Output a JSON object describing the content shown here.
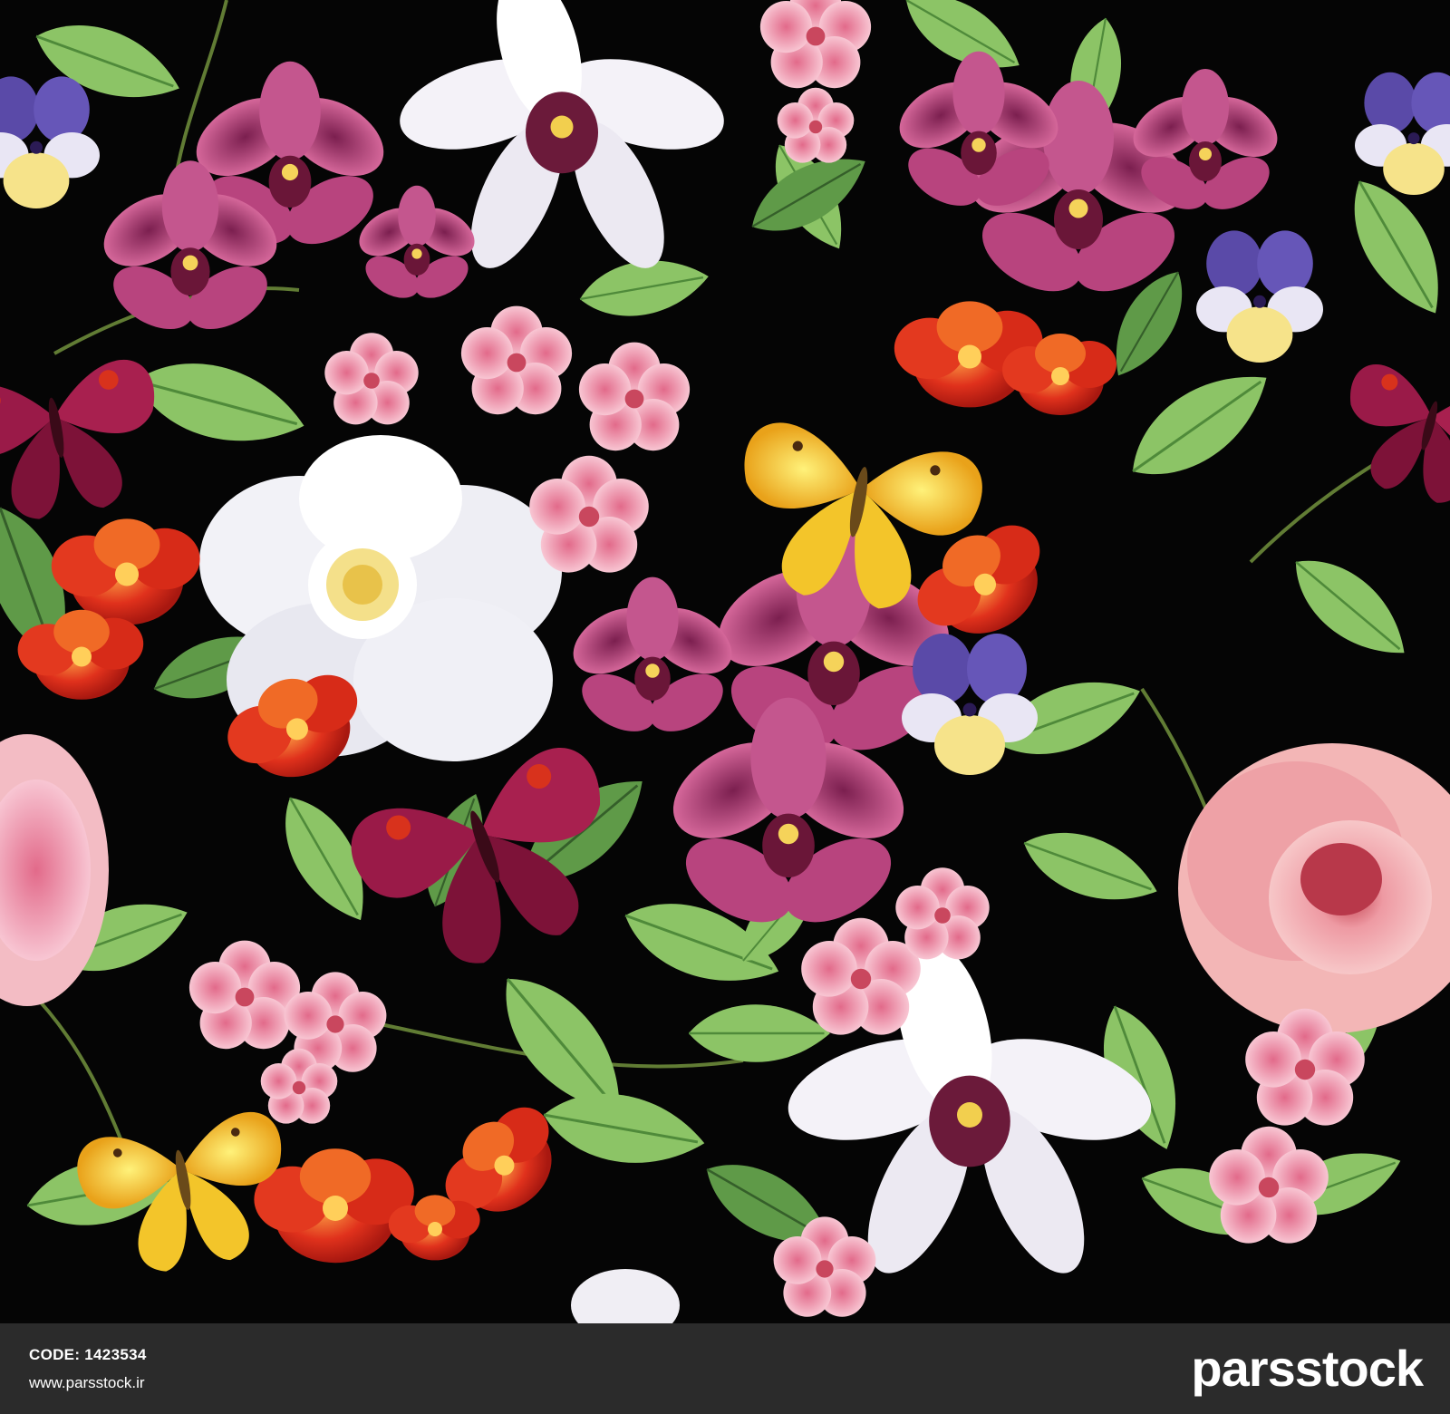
{
  "footer": {
    "code_text": "CODE: 1423534",
    "url_text": "www.parsstock.ir",
    "logo_text": "parsstock"
  },
  "colors": {
    "background": "#050505",
    "footer_bg": "#2b2b2b",
    "footer_text": "#ffffff"
  }
}
